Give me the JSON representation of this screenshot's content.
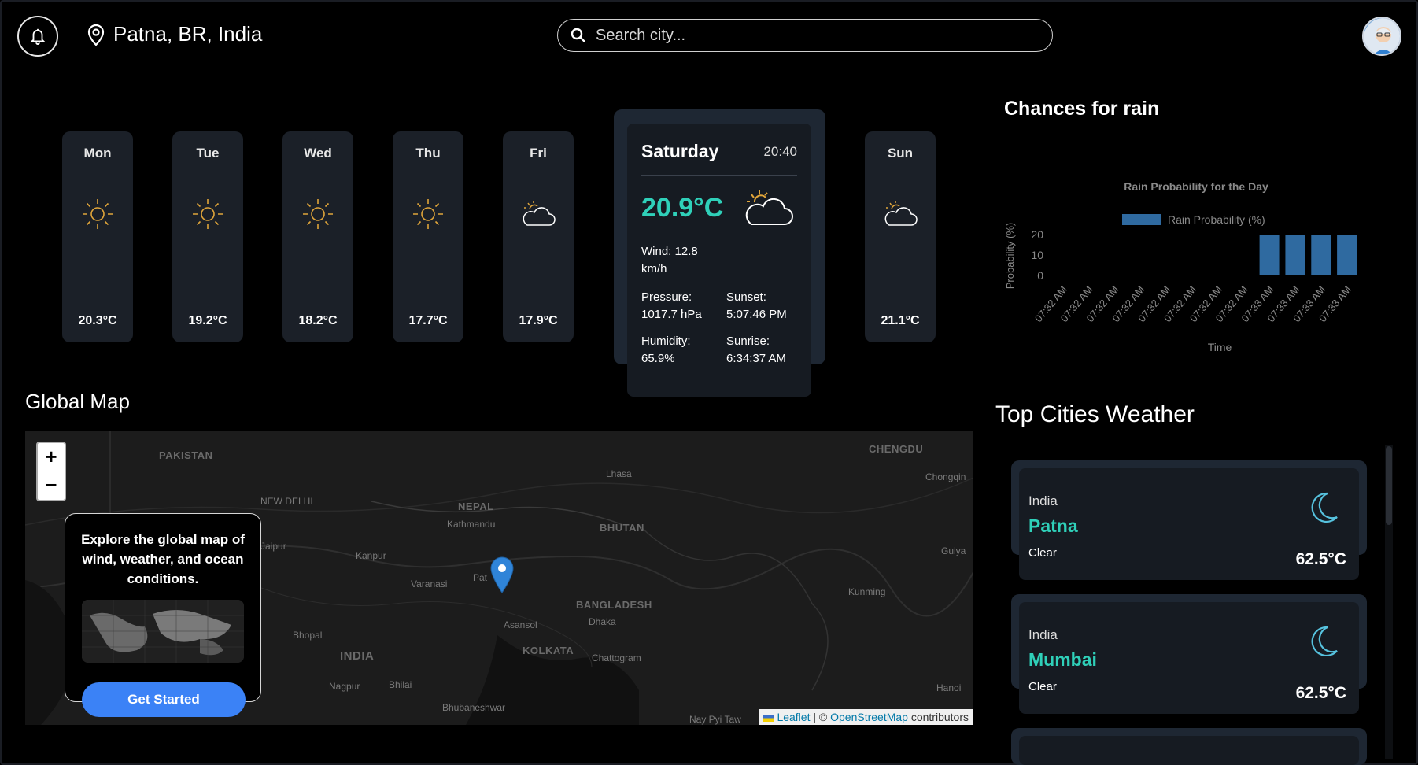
{
  "header": {
    "location": "Patna, BR, India",
    "search_placeholder": "Search city..."
  },
  "forecast": [
    {
      "day": "Mon",
      "temp": "20.3°C",
      "icon": "sun-icon"
    },
    {
      "day": "Tue",
      "temp": "19.2°C",
      "icon": "sun-icon"
    },
    {
      "day": "Wed",
      "temp": "18.2°C",
      "icon": "sun-icon"
    },
    {
      "day": "Thu",
      "temp": "17.7°C",
      "icon": "sun-icon"
    },
    {
      "day": "Fri",
      "temp": "17.9°C",
      "icon": "partly-cloudy-icon"
    },
    {
      "day": "Sun",
      "temp": "21.1°C",
      "icon": "partly-cloudy-icon"
    }
  ],
  "today": {
    "day": "Saturday",
    "time": "20:40",
    "temp": "20.9°C",
    "wind_label": "Wind:",
    "wind_value": "12.8",
    "wind_unit": "km/h",
    "pressure_label": "Pressure:",
    "pressure_value": "1017.7 hPa",
    "sunset_label": "Sunset:",
    "sunset_value": "5:07:46 PM",
    "humidity_label": "Humidity:",
    "humidity_value": "65.9%",
    "sunrise_label": "Sunrise:",
    "sunrise_value": "6:34:37 AM"
  },
  "rain": {
    "section_title": "Chances for rain"
  },
  "chart_data": {
    "type": "bar",
    "title": "Rain Probability for the Day",
    "xlabel": "Time",
    "ylabel": "Probability (%)",
    "ylim": [
      0,
      20
    ],
    "yticks": [
      "20",
      "10",
      "0"
    ],
    "categories": [
      "07:32 AM",
      "07:32 AM",
      "07:32 AM",
      "07:32 AM",
      "07:32 AM",
      "07:32 AM",
      "07:32 AM",
      "07:32 AM",
      "07:33 AM",
      "07:33 AM",
      "07:33 AM",
      "07:33 AM"
    ],
    "series": [
      {
        "name": "Rain Probability (%)",
        "values": [
          0,
          0,
          0,
          0,
          0,
          0,
          0,
          0,
          20,
          20,
          20,
          20
        ]
      }
    ],
    "color": "#2f6aa0",
    "legend": "top"
  },
  "map": {
    "section_title": "Global Map",
    "zoom_in": "+",
    "zoom_out": "−",
    "explore_text": "Explore the global map of wind, weather, and ocean conditions.",
    "cta": "Get Started",
    "attribution_leaflet": "Leaflet",
    "attribution_sep": " | © ",
    "attribution_osm": "OpenStreetMap",
    "attribution_rest": " contributors",
    "labels": [
      {
        "text": "PAKISTAN",
        "kind": "country"
      },
      {
        "text": "NEW DELHI",
        "kind": "city"
      },
      {
        "text": "NEPAL",
        "kind": "country"
      },
      {
        "text": "Kathmandu",
        "kind": "city"
      },
      {
        "text": "BHUTAN",
        "kind": "country"
      },
      {
        "text": "Lhasa",
        "kind": "city"
      },
      {
        "text": "CHENGDU",
        "kind": "country"
      },
      {
        "text": "Chongqin",
        "kind": "city"
      },
      {
        "text": "Jaipur",
        "kind": "city"
      },
      {
        "text": "Kanpur",
        "kind": "city"
      },
      {
        "text": "Varanasi",
        "kind": "city"
      },
      {
        "text": "Pat",
        "kind": "city"
      },
      {
        "text": "Guiya",
        "kind": "city"
      },
      {
        "text": "BANGLADESH",
        "kind": "country"
      },
      {
        "text": "Dhaka",
        "kind": "city"
      },
      {
        "text": "Kunming",
        "kind": "city"
      },
      {
        "text": "Asansol",
        "kind": "city"
      },
      {
        "text": "Bhopal",
        "kind": "city"
      },
      {
        "text": "KOLKATA",
        "kind": "city"
      },
      {
        "text": "Chattogram",
        "kind": "city"
      },
      {
        "text": "INDIA",
        "kind": "country"
      },
      {
        "text": "Nagpur",
        "kind": "city"
      },
      {
        "text": "Bhilai",
        "kind": "city"
      },
      {
        "text": "Hanoi",
        "kind": "city"
      },
      {
        "text": "Bhubaneshwar",
        "kind": "city"
      },
      {
        "text": "Nay Pyi Taw",
        "kind": "city"
      }
    ]
  },
  "cities": {
    "section_title": "Top Cities Weather",
    "items": [
      {
        "country": "India",
        "name": "Patna",
        "condition": "Clear",
        "temp": "62.5°C"
      },
      {
        "country": "India",
        "name": "Mumbai",
        "condition": "Clear",
        "temp": "62.5°C"
      }
    ]
  },
  "colors": {
    "accent": "#2fd0b9",
    "button": "#3b82f6",
    "card": "#1b2028",
    "sun": "#e0a53a"
  }
}
